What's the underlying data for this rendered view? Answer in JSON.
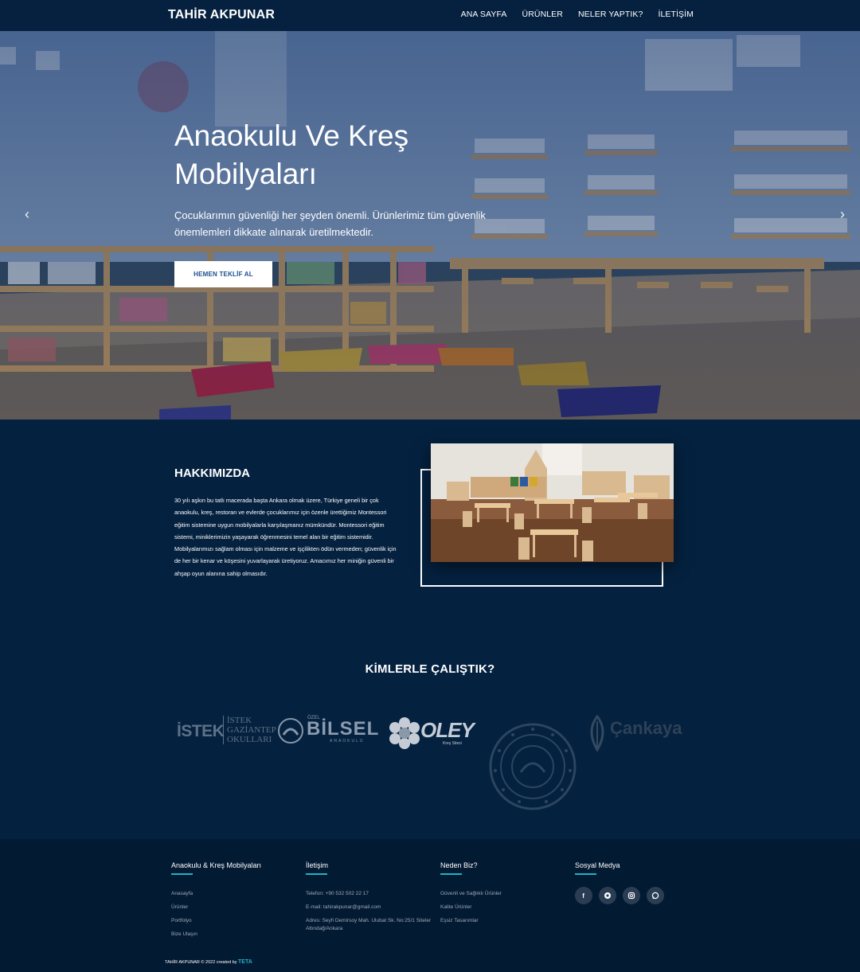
{
  "nav": {
    "brand": "TAHİR AKPUNAR",
    "items": [
      {
        "label": "ANA SAYFA"
      },
      {
        "label": "ÜRÜNLER"
      },
      {
        "label": "NELER YAPTIK?"
      },
      {
        "label": "İLETİŞİM"
      }
    ]
  },
  "hero": {
    "title": "Anaokulu Ve Kreş Mobilyaları",
    "subtitle": "Çocuklarımın güvenliği her şeyden önemli. Ürünlerimiz tüm güvenlik önemlemleri dikkate alınarak üretilmektedir.",
    "button": "HEMEN TEKLİF AL",
    "prev_icon": "chevron-left-icon",
    "next_icon": "chevron-right-icon"
  },
  "about": {
    "title": "HAKKIMIZDA",
    "text": "30 yılı aşkın bu tatlı macerada başta Ankara olmak üzere, Türkiye geneli bir çok anaokulu, kreş, restoran ve evlerde çocuklarımız için özenle ürettiğimiz Montessori eğitim sistemine uygun mobilyalarla karşılaşmanız mümkündür. Montessori eğitim sistemi, miniklerimizin yaşayarak öğrenmesini temel alan bir eğitim sistemidir. Mobilyalarımızı sağlam olması için malzeme ve işçilikten ödün vermeden; güvenlik için de her bir kenar ve köşesini yuvarlayarak üretiyoruz. Amacımız her miniğin güvenli bir ahşap oyun alanına sahip olmasıdır."
  },
  "partners": {
    "title": "KİMLERLE ÇALIŞTIK?",
    "logos": {
      "istek_main": "İSTEK",
      "istek_line1": "İSTEK",
      "istek_line2": "GAZİANTEP",
      "istek_line3": "OKULLARI",
      "bilsel_small": "ÖZEL",
      "bilsel_main": "BİLSEL",
      "bilsel_sub": "ANAOKULU",
      "oley_main": "OLEY",
      "oley_sub": "Kreş Sitesi",
      "cankaya_main": "Çankaya"
    }
  },
  "footer": {
    "col1": {
      "title": "Anaokulu & Kreş Mobilyaları",
      "links": [
        "Anasayfa",
        "Ürünler",
        "Portfolyo",
        "Bize Ulaşın"
      ]
    },
    "col2": {
      "title": "İletişim",
      "phone": "Telefon: +90 532 502 22 17",
      "email": "E-mail: tahirakpunar@gmail.com",
      "address": "Adres: Seyfi Demirsoy Mah. Ulubat Sk. No:25/1 Siteler Altındağ/Ankara"
    },
    "col3": {
      "title": "Neden Biz?",
      "links": [
        "Güvenli ve Sağlıklı Ürünler",
        "Kalite Ürünler",
        "Eşsiz Tasarımlar"
      ]
    },
    "col4": {
      "title": "Sosyal Medya",
      "icons": [
        "facebook-icon",
        "pinterest-icon",
        "instagram-icon",
        "whatsapp-icon"
      ]
    },
    "copyright": "TAHİR AKPUNAR © 2022 created by",
    "creator": "TETA"
  }
}
